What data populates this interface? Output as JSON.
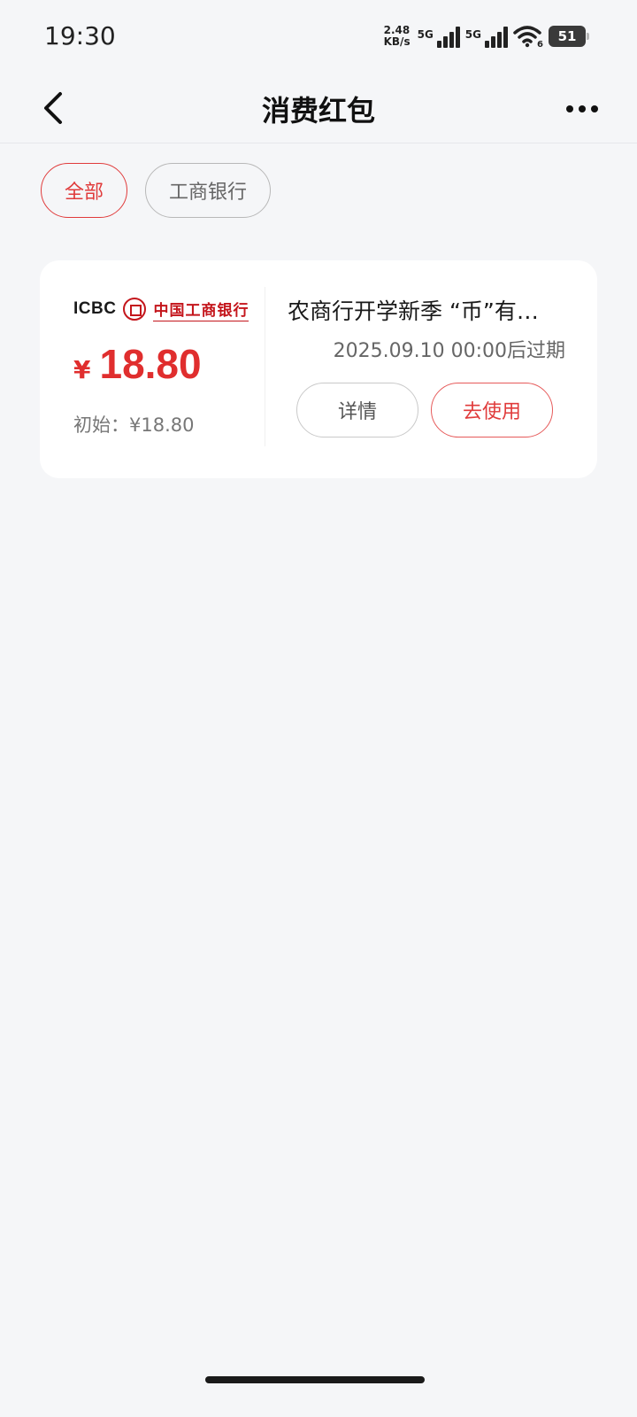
{
  "status_bar": {
    "time": "19:30",
    "net_speed_value": "2.48",
    "net_speed_unit": "KB/s",
    "signal1_label": "5G",
    "signal2_label": "5G",
    "wifi_label": "6",
    "battery": "51"
  },
  "nav": {
    "title": "消费红包",
    "back_icon": "chevron-left-icon",
    "more_icon": "more-dots-icon"
  },
  "filters": [
    {
      "label": "全部",
      "active": true
    },
    {
      "label": "工商银行",
      "active": false
    }
  ],
  "card": {
    "bank_logo_en": "ICBC",
    "bank_logo_cn": "中国工商银行",
    "currency": "¥",
    "amount": "18.80",
    "initial_label": "初始：¥18.80",
    "title": "农商行开学新季 “币”有…",
    "expiry": "2025.09.10 00:00后过期",
    "detail_button": "详情",
    "use_button": "去使用"
  },
  "colors": {
    "accent": "#e03b3b",
    "background": "#f5f6f8",
    "brand_red": "#c4161c"
  }
}
